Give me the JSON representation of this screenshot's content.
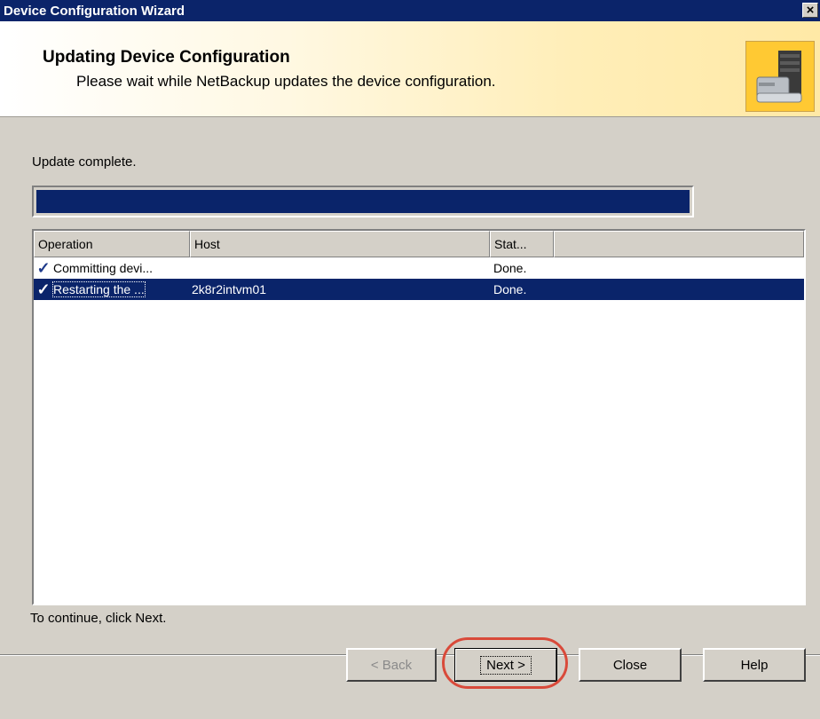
{
  "window": {
    "title": "Device Configuration Wizard",
    "close_icon": "close-icon",
    "close_label": "×"
  },
  "banner": {
    "heading": "Updating Device Configuration",
    "subheading": "Please wait while NetBackup updates the device configuration.",
    "image": "server-device-icon"
  },
  "status": {
    "text": "Update complete.",
    "progress": 1.0
  },
  "table": {
    "columns": [
      "Operation",
      "Host",
      "Stat...",
      ""
    ],
    "rows": [
      {
        "operation": "Committing devi...",
        "host": "",
        "status": "Done.",
        "icon": "check-icon",
        "check": "✓",
        "selected": false
      },
      {
        "operation": "Restarting the ...",
        "host": "2k8r2intvm01",
        "status": "Done.",
        "icon": "check-icon",
        "check": "✓",
        "selected": true
      }
    ]
  },
  "hint": "To continue, click Next.",
  "buttons": {
    "back": "< Back",
    "next": "Next >",
    "close": "Close",
    "help": "Help"
  },
  "colors": {
    "title_bar": "#0b246a",
    "selection": "#0a246a",
    "highlight_ring": "#d94a3a"
  }
}
